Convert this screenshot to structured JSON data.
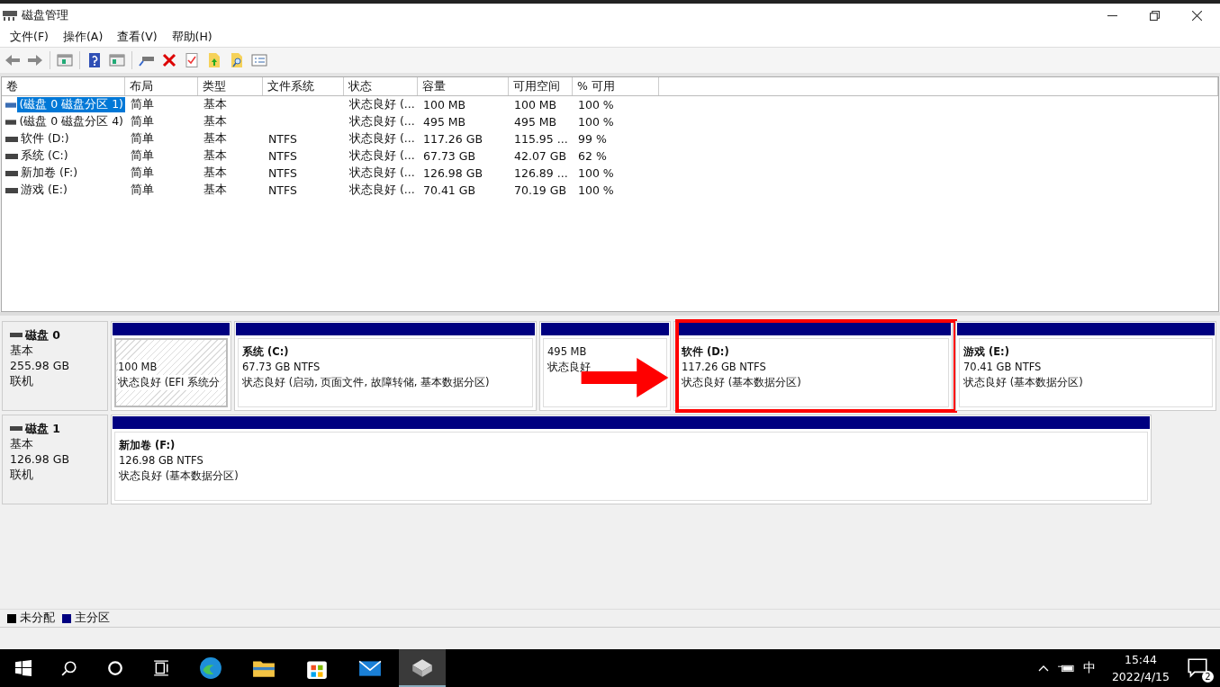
{
  "window": {
    "title": "磁盘管理"
  },
  "menu": [
    "文件(F)",
    "操作(A)",
    "查看(V)",
    "帮助(H)"
  ],
  "table": {
    "columns": [
      "卷",
      "布局",
      "类型",
      "文件系统",
      "状态",
      "容量",
      "可用空间",
      "% 可用"
    ],
    "rows": [
      {
        "selected": true,
        "cells": [
          "(磁盘 0 磁盘分区 1)",
          "简单",
          "基本",
          "",
          "状态良好 (...",
          "100 MB",
          "100 MB",
          "100 %"
        ]
      },
      {
        "selected": false,
        "cells": [
          "(磁盘 0 磁盘分区 4)",
          "简单",
          "基本",
          "",
          "状态良好 (...",
          "495 MB",
          "495 MB",
          "100 %"
        ]
      },
      {
        "selected": false,
        "cells": [
          "软件 (D:)",
          "简单",
          "基本",
          "NTFS",
          "状态良好 (...",
          "117.26 GB",
          "115.95 ...",
          "99 %"
        ]
      },
      {
        "selected": false,
        "cells": [
          "系统 (C:)",
          "简单",
          "基本",
          "NTFS",
          "状态良好 (...",
          "67.73 GB",
          "42.07 GB",
          "62 %"
        ]
      },
      {
        "selected": false,
        "cells": [
          "新加卷 (F:)",
          "简单",
          "基本",
          "NTFS",
          "状态良好 (...",
          "126.98 GB",
          "126.89 ...",
          "100 %"
        ]
      },
      {
        "selected": false,
        "cells": [
          "游戏 (E:)",
          "简单",
          "基本",
          "NTFS",
          "状态良好 (...",
          "70.41 GB",
          "70.19 GB",
          "100 %"
        ]
      }
    ]
  },
  "disks": [
    {
      "name": "磁盘 0",
      "type": "基本",
      "size": "255.98 GB",
      "status": "联机",
      "partitions": [
        {
          "selected": true,
          "highlighted": false,
          "size": "100 MB",
          "status": "状态良好 (EFI 系统分"
        },
        {
          "selected": false,
          "highlighted": false,
          "title": "系统  (C:)",
          "size": "67.73 GB NTFS",
          "status": "状态良好 (启动, 页面文件, 故障转储, 基本数据分区)"
        },
        {
          "selected": false,
          "highlighted": false,
          "size": "495 MB",
          "status": "状态良好"
        },
        {
          "selected": false,
          "highlighted": true,
          "title": "软件  (D:)",
          "size": "117.26 GB NTFS",
          "status": "状态良好 (基本数据分区)"
        },
        {
          "selected": false,
          "highlighted": false,
          "title": "游戏  (E:)",
          "size": "70.41 GB NTFS",
          "status": "状态良好 (基本数据分区)"
        }
      ]
    },
    {
      "name": "磁盘 1",
      "type": "基本",
      "size": "126.98 GB",
      "status": "联机",
      "partitions": [
        {
          "selected": false,
          "highlighted": false,
          "title": "新加卷  (F:)",
          "size": "126.98 GB NTFS",
          "status": "状态良好 (基本数据分区)"
        }
      ]
    }
  ],
  "legend": [
    {
      "label": "未分配",
      "color": "#000000"
    },
    {
      "label": "主分区",
      "color": "#000080"
    }
  ],
  "taskbar": {
    "ime": "中",
    "time": "15:44",
    "date": "2022/4/15",
    "notifications": "2"
  }
}
